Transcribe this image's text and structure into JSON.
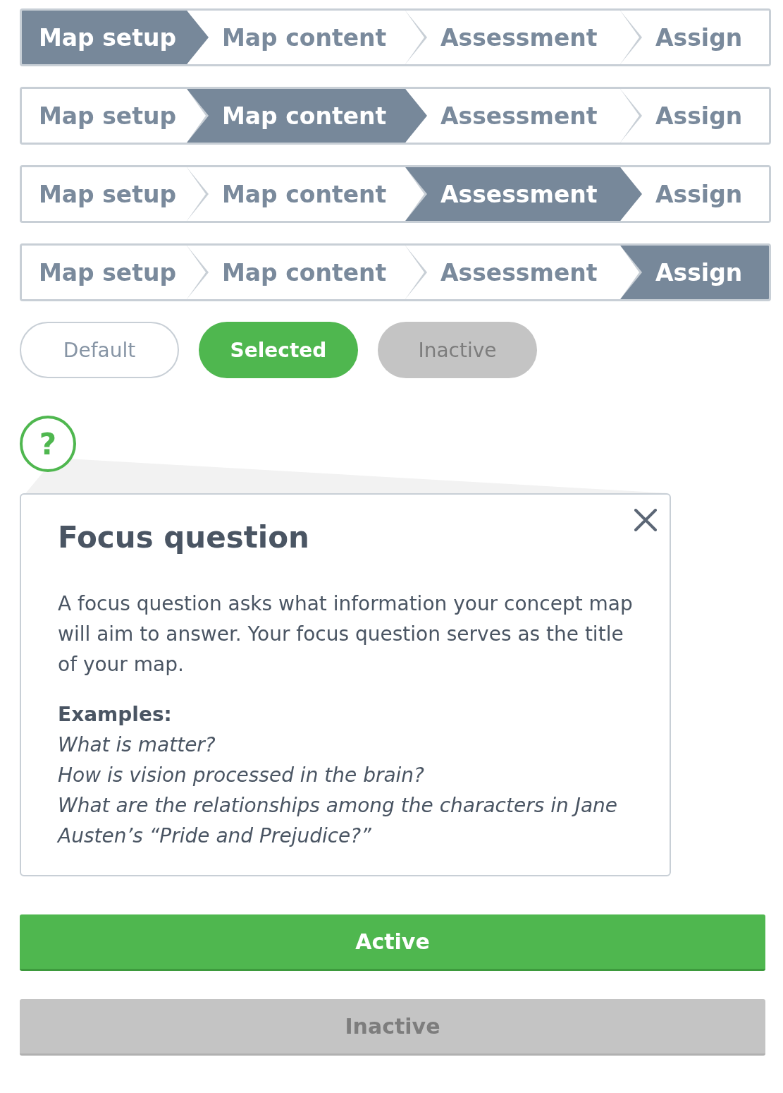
{
  "steppers": [
    {
      "steps": [
        {
          "label": "Map setup",
          "selected": true
        },
        {
          "label": "Map content",
          "selected": false
        },
        {
          "label": "Assessment",
          "selected": false
        },
        {
          "label": "Assign",
          "selected": false
        }
      ]
    },
    {
      "steps": [
        {
          "label": "Map setup",
          "selected": false
        },
        {
          "label": "Map content",
          "selected": true
        },
        {
          "label": "Assessment",
          "selected": false
        },
        {
          "label": "Assign",
          "selected": false
        }
      ]
    },
    {
      "steps": [
        {
          "label": "Map setup",
          "selected": false
        },
        {
          "label": "Map content",
          "selected": false
        },
        {
          "label": "Assessment",
          "selected": true
        },
        {
          "label": "Assign",
          "selected": false
        }
      ]
    },
    {
      "steps": [
        {
          "label": "Map setup",
          "selected": false
        },
        {
          "label": "Map content",
          "selected": false
        },
        {
          "label": "Assessment",
          "selected": false
        },
        {
          "label": "Assign",
          "selected": true
        }
      ]
    }
  ],
  "pills": [
    {
      "label": "Default",
      "kind": "default"
    },
    {
      "label": "Selected",
      "kind": "selected"
    },
    {
      "label": "Inactive",
      "kind": "inactive"
    }
  ],
  "help": {
    "icon": "?",
    "title": "Focus question",
    "body": "A focus question asks what information your concept map will aim to answer. Your focus question serves as the title of your map.",
    "examples_label": "Examples:",
    "examples": [
      "What is matter?",
      "How is vision processed in the brain?",
      "What are the relationships among the characters in Jane Austen’s “Pride and Prejudice?”"
    ]
  },
  "buttons": [
    {
      "label": "Active",
      "kind": "active"
    },
    {
      "label": "Inactive",
      "kind": "inactive"
    }
  ]
}
